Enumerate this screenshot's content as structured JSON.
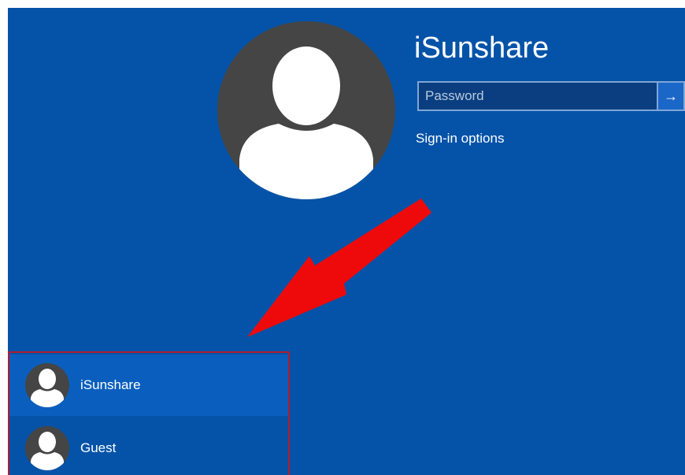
{
  "account": {
    "name": "iSunshare"
  },
  "password": {
    "placeholder": "Password",
    "submit_glyph": "→"
  },
  "signin_options_label": "Sign-in options",
  "user_list": [
    {
      "name": "iSunshare",
      "selected": true
    },
    {
      "name": "Guest",
      "selected": false
    }
  ],
  "colors": {
    "background": "#0553a8",
    "avatar": "#454545",
    "highlight_border": "#b01c2e",
    "annotation_arrow": "#ee0a0a"
  },
  "icons": [
    "user-avatar-icon",
    "arrow-right-icon",
    "annotation-arrow"
  ]
}
